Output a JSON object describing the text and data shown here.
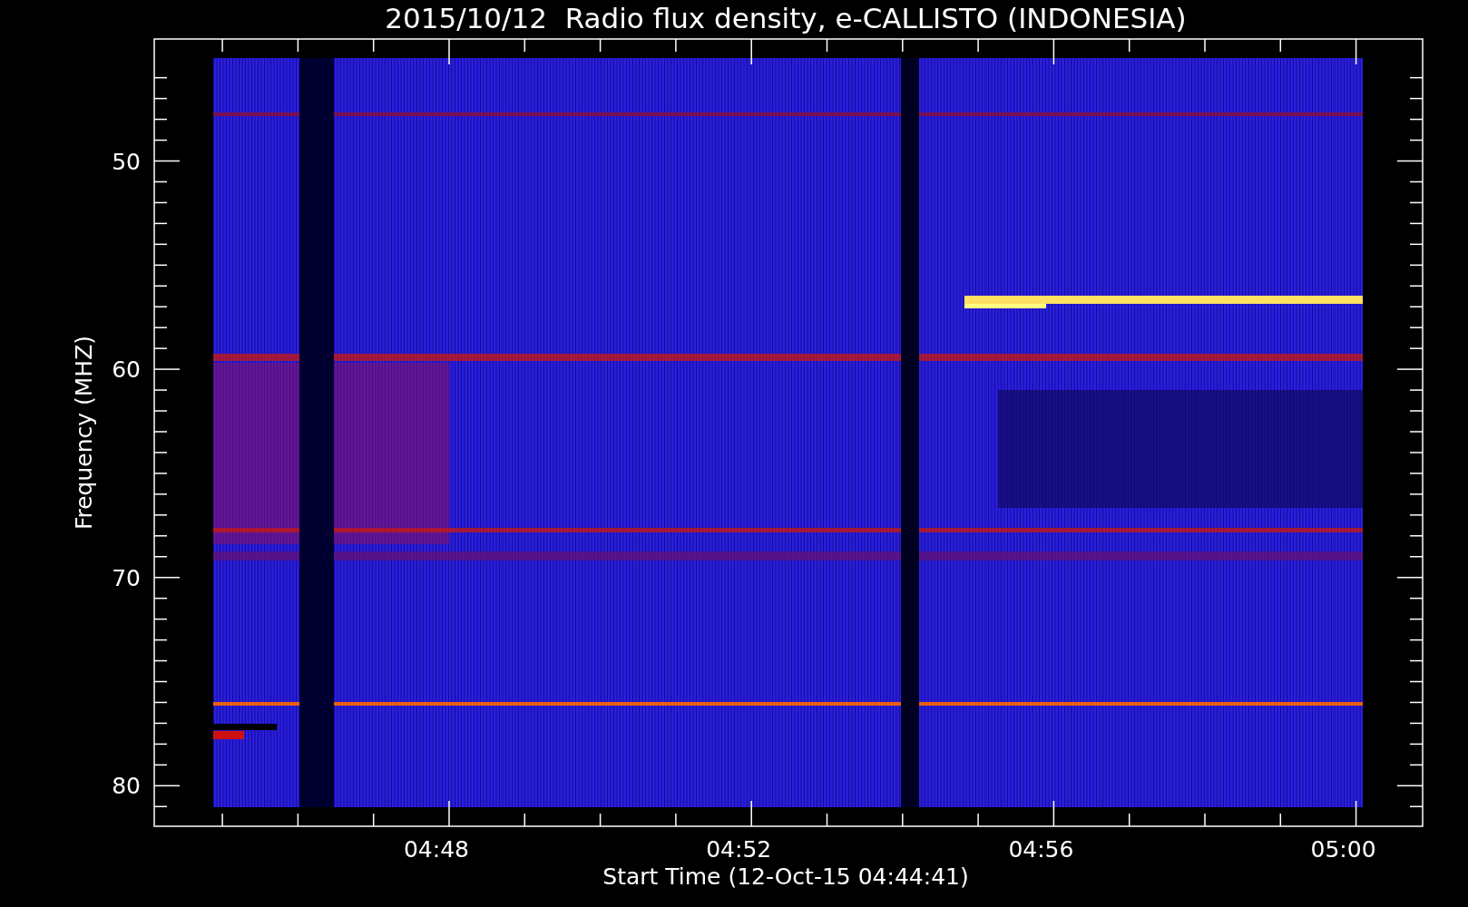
{
  "plot": {
    "title": "2015/10/12  Radio flux density, e-CALLISTO (INDONESIA)",
    "xlabel": "Start Time (12-Oct-15 04:44:41)",
    "ylabel": "Frequency (MHZ)",
    "xticks": [
      "04:48",
      "04:52",
      "04:56",
      "05:00"
    ],
    "yticks": [
      "50",
      "60",
      "70",
      "80"
    ]
  }
}
